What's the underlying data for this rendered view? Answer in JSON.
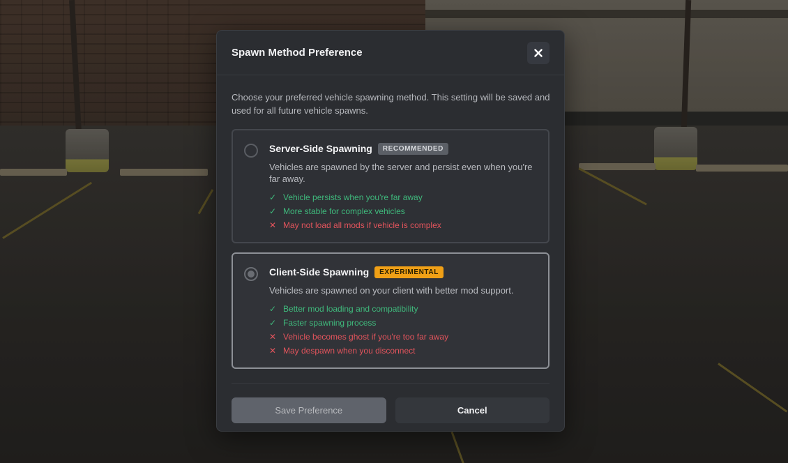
{
  "dialog": {
    "title": "Spawn Method Preference",
    "intro": "Choose your preferred vehicle spawning method. This setting will be saved and used for all future vehicle spawns."
  },
  "options": [
    {
      "title": "Server-Side Spawning",
      "badge": "RECOMMENDED",
      "selected": false,
      "description": "Vehicles are spawned by the server and persist even when you're far away.",
      "pros": [
        "Vehicle persists when you're far away",
        "More stable for complex vehicles"
      ],
      "cons": [
        "May not load all mods if vehicle is complex"
      ]
    },
    {
      "title": "Client-Side Spawning",
      "badge": "EXPERIMENTAL",
      "selected": true,
      "description": "Vehicles are spawned on your client with better mod support.",
      "pros": [
        "Better mod loading and compatibility",
        "Faster spawning process"
      ],
      "cons": [
        "Vehicle becomes ghost if you're too far away",
        "May despawn when you disconnect"
      ]
    }
  ],
  "footer": {
    "save_label": "Save Preference",
    "cancel_label": "Cancel"
  },
  "icons": {
    "close": "close-icon",
    "pro": "check-icon",
    "con": "cross-icon"
  },
  "colors": {
    "pro": "#3fb97c",
    "con": "#e2545c",
    "experimental_badge": "#f0a016",
    "recommended_badge": "#5b5f66"
  }
}
